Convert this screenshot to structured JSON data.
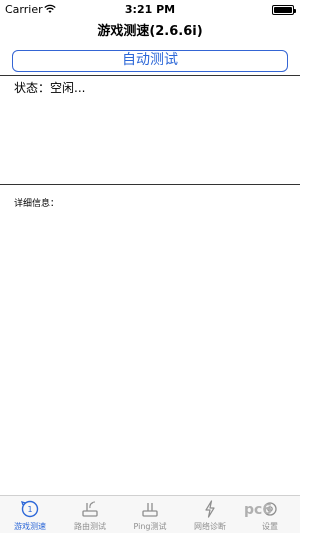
{
  "status_bar": {
    "carrier": "Carrier",
    "time": "3:21 PM"
  },
  "nav": {
    "title": "游戏测速(2.6.6i)"
  },
  "main": {
    "auto_test_label": "自动测试",
    "status_text": "状态：空闲...",
    "detail_label": "详细信息："
  },
  "tabbar": {
    "items": [
      {
        "label": "游戏测速",
        "icon": "speed-test-icon",
        "active": true
      },
      {
        "label": "路由测试",
        "icon": "router-icon",
        "active": false
      },
      {
        "label": "Ping测试",
        "icon": "ping-icon",
        "active": false
      },
      {
        "label": "网络诊断",
        "icon": "lightning-icon",
        "active": false
      },
      {
        "label": "设置",
        "icon": "settings-icon",
        "active": false
      }
    ]
  },
  "watermark": {
    "text": "pc6"
  },
  "colors": {
    "accent": "#2d68d8",
    "inactive": "#8e8e8e"
  }
}
